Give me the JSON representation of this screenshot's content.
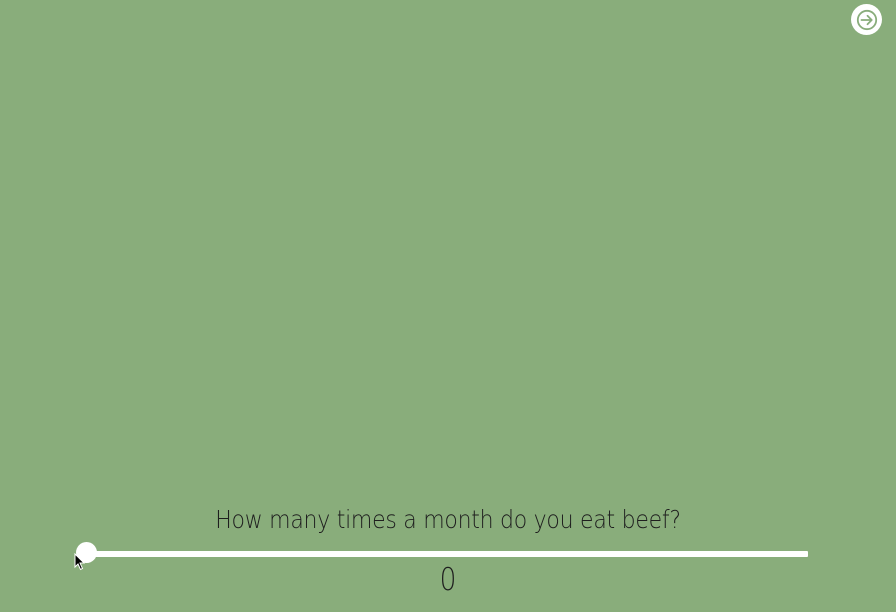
{
  "colors": {
    "background": "#89ad7b",
    "foreground": "#ffffff",
    "text": "#1e1e1e"
  },
  "nav": {
    "next_icon": "arrow-right-circle-icon"
  },
  "question": {
    "text": "How many times a month do you eat beef?"
  },
  "slider": {
    "value": "0",
    "level_fraction": 0
  }
}
